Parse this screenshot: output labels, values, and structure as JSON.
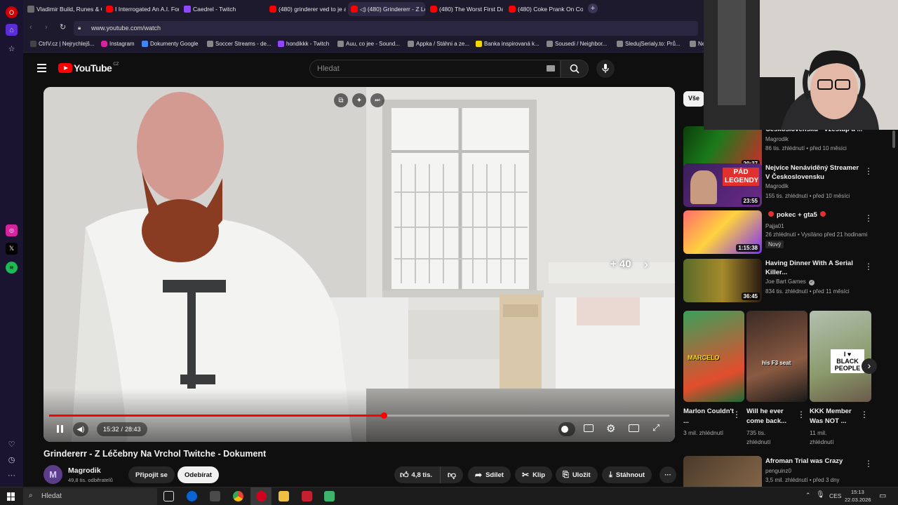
{
  "browser": {
    "tabs": [
      {
        "label": "Vladimir Build, Runes & C",
        "active": false
      },
      {
        "label": "I Interrogated An A.I. For 7",
        "active": false
      },
      {
        "label": "Caedrel - Twitch",
        "active": false
      },
      {
        "label": "(480) grinderer ved to je a",
        "active": false
      },
      {
        "label": "(480) Grindererr - Z Lé",
        "active": true
      },
      {
        "label": "(480) The Worst First Date",
        "active": false
      },
      {
        "label": "(480) Coke Prank On Cop",
        "active": false
      }
    ],
    "new_tab_glyph": "+",
    "url": "www.youtube.com/watch",
    "bookmarks": [
      "CtrlV.cz | Nejrychlejš...",
      "Instagram",
      "Dokumenty Google",
      "Soccer Streams - de...",
      "hondikkk - Twitch",
      "Auu, co jee - Sound...",
      "Appka / Stáhni a ze...",
      "Banka inspirovaná k...",
      "Sousedi / Neighbor...",
      "SledujSerialy.to: Prů...",
      "Ne"
    ]
  },
  "youtube": {
    "logo_text": "YouTube",
    "country_code": "CZ",
    "search_placeholder": "Hledat",
    "filter_chip": "Vše"
  },
  "player": {
    "time_current": "15:32",
    "time_total": "28:43",
    "progress_fraction": 0.54,
    "skip_overlay": "+ 40"
  },
  "video": {
    "title": "Grindererr - Z Léčebny Na Vrchol Twitche - Dokument",
    "channel": "Magrodik",
    "subscribers": "49,8 tis. odběratelů",
    "join_label": "Připojit se",
    "subscribe_label": "Odebírat",
    "likes": "4,8 tis.",
    "share_label": "Sdílet",
    "clip_label": "Klip",
    "save_label": "Uložit",
    "download_label": "Stáhnout"
  },
  "recommendations": [
    {
      "title": "Československu - Vzestup a ...",
      "channel": "Magrodik",
      "meta": "86 tis. zhlédnutí • před 10 měsíci",
      "duration": "20:37",
      "thumb_text": ""
    },
    {
      "title": "Nejvíce Nenáviděný Streamer V Československu",
      "channel": "Magrodik",
      "meta": "155 tis. zhlédnutí • před 10 měsíci",
      "duration": "23:55",
      "thumb_text": "PÁD LEGENDY"
    },
    {
      "title": "pokec + gta5",
      "channel": "Pajja01",
      "meta": "26 zhlédnutí • Vysíláno před 21 hodinami",
      "duration": "1:15:38",
      "badge": "Nový",
      "thumb_text": ""
    },
    {
      "title": "Having Dinner With A Serial Killer...",
      "channel": "Joe Bart Games",
      "meta": "834 tis. zhlédnutí • před 11 měsíci",
      "duration": "36:45",
      "thumb_text": ""
    },
    {
      "title": "Afroman Trial was Crazy",
      "channel": "penguinz0",
      "meta": "3,5 mil. zhlédnutí • před 3 dny",
      "duration": "",
      "thumb_text": ""
    }
  ],
  "shorts": [
    {
      "title": "Marlon Couldn't ...",
      "views": "3 mil. zhlédnutí",
      "thumb_text": "MARCELO"
    },
    {
      "title": "Will he ever come back...",
      "views": "735 tis. zhlédnutí",
      "thumb_text": "his F3 seat"
    },
    {
      "title": "KKK Member Was NOT ...",
      "views": "11 mil. zhlédnutí",
      "thumb_text": "I ♥ BLACK PEOPLE"
    }
  ],
  "taskbar": {
    "search_placeholder": "Hledat",
    "language": "CES",
    "time": "15:13",
    "date": "22.03.2026"
  }
}
